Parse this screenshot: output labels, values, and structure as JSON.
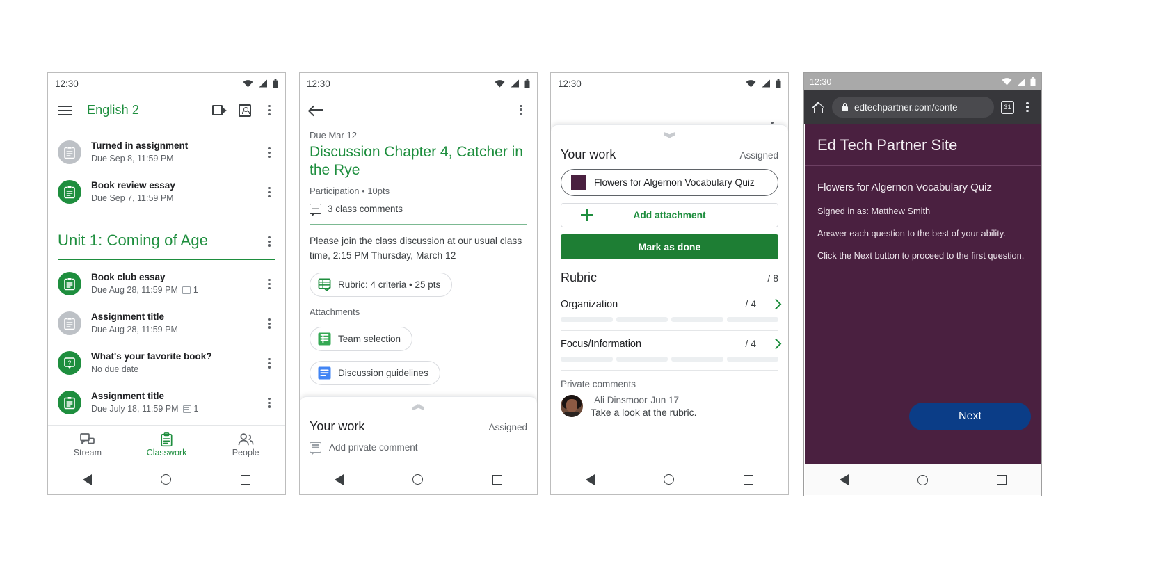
{
  "phone1": {
    "statusbar": {
      "clock": "12:30"
    },
    "appbar": {
      "title": "English 2",
      "menu_icon": "hamburger-icon",
      "meet_icon": "video-camera-icon",
      "class_icon": "class-card-icon",
      "overflow_icon": "kebab-menu-icon"
    },
    "top_items": [
      {
        "title": "Turned in assignment",
        "due": "Due Sep 8, 11:59 PM",
        "state": "grey",
        "comments": ""
      },
      {
        "title": "Book review essay",
        "due": "Due Sep 7, 11:59 PM",
        "state": "green",
        "comments": ""
      }
    ],
    "unit": {
      "title": "Unit 1: Coming of Age"
    },
    "unit_items": [
      {
        "title": "Book club essay",
        "due": "Due Aug 28, 11:59 PM",
        "state": "green",
        "comments": "1",
        "icon": "assignment-icon"
      },
      {
        "title": "Assignment title",
        "due": "Due Aug 28, 11:59 PM",
        "state": "grey",
        "comments": "",
        "icon": "assignment-icon"
      },
      {
        "title": "What's your favorite book?",
        "due": "No due date",
        "state": "green",
        "comments": "",
        "icon": "question-icon"
      },
      {
        "title": "Assignment title",
        "due": "Due July 18, 11:59 PM",
        "state": "green",
        "comments": "1",
        "icon": "assignment-icon"
      }
    ],
    "bottomnav": [
      {
        "label": "Stream",
        "icon": "stream-icon",
        "active": false
      },
      {
        "label": "Classwork",
        "icon": "clipboard-icon",
        "active": true
      },
      {
        "label": "People",
        "icon": "people-icon",
        "active": false
      }
    ]
  },
  "phone2": {
    "statusbar": {
      "clock": "12:30"
    },
    "back_icon": "arrow-back-icon",
    "overflow_icon": "kebab-menu-icon",
    "due_label": "Due Mar 12",
    "title": "Discussion Chapter 4, Catcher in the Rye",
    "subtitle": "Participation • 10pts",
    "class_comments": "3 class comments",
    "description": "Please join the class discussion at our usual class time, 2:15 PM Thursday, March 12",
    "rubric_chip": {
      "label": "Rubric: 4 criteria • 25 pts",
      "icon": "rubric-grid-icon"
    },
    "attachments_label": "Attachments",
    "attachments": [
      {
        "label": "Team selection",
        "icon": "google-sheets-icon",
        "color": "#34a853"
      },
      {
        "label": "Discussion guidelines",
        "icon": "google-docs-icon",
        "color": "#4285f4"
      }
    ],
    "your_work": {
      "heading": "Your work",
      "status": "Assigned",
      "private_comment_placeholder": "Add private comment",
      "comment_icon": "comment-icon"
    }
  },
  "phone3": {
    "statusbar": {
      "clock": "12:30"
    },
    "overflow_icon": "kebab-menu-icon",
    "your_work": {
      "heading": "Your work",
      "status": "Assigned"
    },
    "attachment": {
      "label": "Flowers for Algernon Vocabulary Quiz",
      "thumb_color": "#4a2040"
    },
    "add_attachment": {
      "label": "Add attachment",
      "icon": "plus-icon"
    },
    "mark_done": {
      "label": "Mark as done",
      "color": "#1e7e34"
    },
    "rubric": {
      "heading": "Rubric",
      "total": "/ 8"
    },
    "criteria": [
      {
        "name": "Organization",
        "score": "/ 4",
        "levels": 4
      },
      {
        "name": "Focus/Information",
        "score": "/ 4",
        "levels": 4
      }
    ],
    "private_comments": {
      "heading": "Private comments",
      "entries": [
        {
          "author": "Ali Dinsmoor",
          "date": "Jun 17",
          "text": "Take a look at the rubric.",
          "avatar": "user-avatar"
        }
      ]
    }
  },
  "phone4": {
    "statusbar": {
      "clock": "12:30"
    },
    "browser": {
      "home_icon": "home-icon",
      "lock_icon": "lock-icon",
      "url": "edtechpartner.com/conte",
      "tab_count": "31",
      "tabs_icon": "tab-switcher-icon",
      "overflow_icon": "kebab-menu-icon"
    },
    "page": {
      "site_title": "Ed Tech Partner Site",
      "quiz_title": "Flowers for Algernon Vocabulary Quiz",
      "lines": [
        "Signed in as: Matthew Smith",
        "Answer each question to the best of your ability.",
        "Click the Next button to proceed to the first question."
      ],
      "next_button": "Next",
      "bg_color": "#4a2040",
      "button_color": "#0b3d87"
    }
  }
}
